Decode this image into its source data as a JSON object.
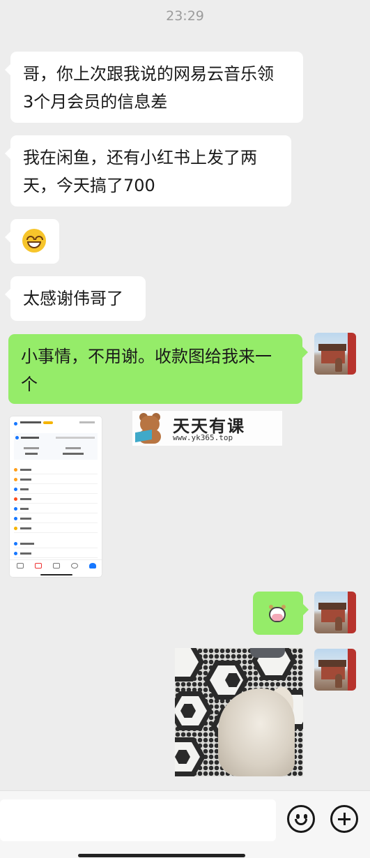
{
  "status": {
    "time": "23:29"
  },
  "messages": [
    {
      "side": "left",
      "text_line1": "哥，你上次跟我说的网易云音乐领",
      "text_line2": "3个月会员的信息差"
    },
    {
      "side": "left",
      "text_line1": "我在闲鱼，还有小红书上发了两",
      "text_line2": "天，今天搞了700"
    },
    {
      "side": "left",
      "emoji": "grinning-face-emoji"
    },
    {
      "side": "left",
      "text": "太感谢伟哥了"
    },
    {
      "side": "right",
      "text_line1": "小事情，不用谢。收款图给我来一",
      "text_line2": "个"
    },
    {
      "side": "left",
      "type": "image",
      "content": "payment-app-screenshot"
    },
    {
      "side": "right",
      "emoji": "cow-face-emoji"
    },
    {
      "side": "right",
      "type": "image",
      "content": "cat-on-tiled-floor-photo"
    }
  ],
  "watermark": {
    "title": "天天有课",
    "url": "www.yk365.top"
  },
  "input_bar": {
    "emoji_icon": "smile-icon",
    "plus_icon": "plus-icon"
  }
}
